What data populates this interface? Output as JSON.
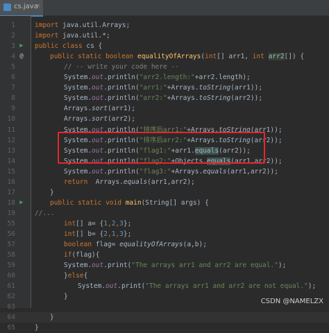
{
  "tab": {
    "label": "cs.java",
    "close": "×"
  },
  "lines": [
    {
      "n": "1"
    },
    {
      "n": "2"
    },
    {
      "n": "3"
    },
    {
      "n": "4"
    },
    {
      "n": "5"
    },
    {
      "n": "6"
    },
    {
      "n": "7"
    },
    {
      "n": "8"
    },
    {
      "n": "9"
    },
    {
      "n": "10"
    },
    {
      "n": "11"
    },
    {
      "n": "12"
    },
    {
      "n": "13"
    },
    {
      "n": "14"
    },
    {
      "n": "15"
    },
    {
      "n": "16"
    },
    {
      "n": "17"
    },
    {
      "n": "18"
    },
    {
      "n": "19"
    },
    {
      "n": "55"
    },
    {
      "n": "56"
    },
    {
      "n": "57"
    },
    {
      "n": "58"
    },
    {
      "n": "59"
    },
    {
      "n": "60"
    },
    {
      "n": "61"
    },
    {
      "n": "62"
    },
    {
      "n": "63"
    },
    {
      "n": "64"
    },
    {
      "n": "65"
    }
  ],
  "code": {
    "l1": [
      "import",
      " java.util.Arrays;"
    ],
    "l2": [
      "import",
      " java.util.*;"
    ],
    "l3": [
      "public class",
      " cs {"
    ],
    "l4": [
      "public static boolean",
      " ",
      "equalityOfArrays",
      "(",
      "int",
      "[] arr1, ",
      "int",
      " ",
      "arr2",
      "[]) {"
    ],
    "l5": "// -- write your code here --",
    "l6": [
      "System.",
      "out",
      ".println(",
      "\"arr2.length:\"",
      "+arr2.length);"
    ],
    "l7": [
      "System.",
      "out",
      ".println(",
      "\"arr1:\"",
      "+Arrays.",
      "toString",
      "(arr1));"
    ],
    "l8": [
      "System.",
      "out",
      ".println(",
      "\"arr2:\"",
      "+Arrays.",
      "toString",
      "(arr2));"
    ],
    "l9": [
      "Arrays.",
      "sort",
      "(arr1);"
    ],
    "l10": [
      "Arrays.",
      "sort",
      "(arr2);"
    ],
    "l11": [
      "System.",
      "out",
      ".println(",
      "\"排序后arr1:\"",
      "+Arrays.",
      "toString",
      "(arr1));"
    ],
    "l12": [
      "System.",
      "out",
      ".println(",
      "\"排序后arr2:\"",
      "+Arrays.",
      "toString",
      "(arr2));"
    ],
    "l13": [
      "System.",
      "out",
      ".println(",
      "\"flag1:\"",
      "+arr1.",
      "equals",
      "(arr2));"
    ],
    "l14": [
      "System.",
      "out",
      ".println(",
      "\"flag2:\"",
      "+Objects.",
      "equals",
      "(arr1,arr2));"
    ],
    "l15": [
      "System.",
      "out",
      ".println(",
      "\"flag3:\"",
      "+Arrays.",
      "equals",
      "(arr1,arr2));"
    ],
    "l16": [
      "return",
      "  Arrays.",
      "equals",
      "(arr1,arr2);"
    ],
    "l17": "}",
    "l18": [
      "public static void",
      " ",
      "main",
      "(String[] args) {"
    ],
    "l19": "//...",
    "l55": [
      "int",
      "[] a= {",
      "1",
      ",",
      "2",
      ",",
      "3",
      "};"
    ],
    "l56": [
      "int",
      "[] b= {",
      "2",
      ",",
      "1",
      ",",
      "3",
      "};"
    ],
    "l57": [
      "boolean",
      " flag= ",
      "equalityOfArrays",
      "(a,b);"
    ],
    "l58": [
      "if",
      "(flag){"
    ],
    "l59": [
      "System.",
      "out",
      ".print(",
      "\"The arrays arr1 and arr2 are equal.\"",
      ");"
    ],
    "l60": [
      "}",
      "else",
      "{"
    ],
    "l61": [
      "System.",
      "out",
      ".print(",
      "\"The arrays arr1 and arr2 are not equal.\"",
      ");"
    ],
    "l62": "}",
    "l63": "",
    "l64": "}",
    "l65": "}"
  },
  "gutter_marks": {
    "run": "▶",
    "override": "@"
  },
  "watermark": "CSDN @NAMELZX"
}
